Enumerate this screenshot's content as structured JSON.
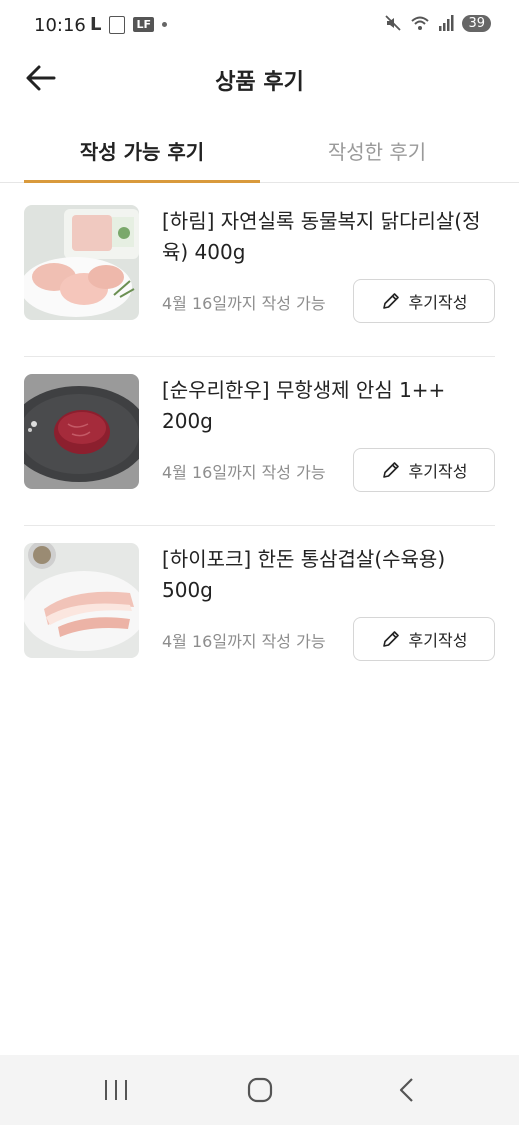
{
  "status_bar": {
    "time": "10:16",
    "battery": "39",
    "left_icons": [
      "l-icon",
      "image-icon",
      "lf-icon",
      "dot-icon"
    ],
    "right_icons": [
      "mute-icon",
      "wifi-icon",
      "signal-icon",
      "battery-icon"
    ]
  },
  "header": {
    "title": "상품 후기",
    "back_icon": "arrow-left-icon"
  },
  "tabs": [
    {
      "label": "작성 가능 후기",
      "active": true
    },
    {
      "label": "작성한 후기",
      "active": false
    }
  ],
  "accent_color": "#d99a3c",
  "items": [
    {
      "name": "[하림] 자연실록 동물복지 닭다리살(정육) 400g",
      "deadline": "4월 16일까지 작성 가능",
      "button_label": "후기작성",
      "image": "chicken-thigh-photo"
    },
    {
      "name": "[순우리한우] 무항생제 안심 1++ 200g",
      "deadline": "4월 16일까지 작성 가능",
      "button_label": "후기작성",
      "image": "beef-tenderloin-photo"
    },
    {
      "name": "[하이포크] 한돈 통삼겹살(수육용) 500g",
      "deadline": "4월 16일까지 작성 가능",
      "button_label": "후기작성",
      "image": "pork-belly-photo"
    }
  ],
  "nav_bar": [
    "recent-apps-icon",
    "home-icon",
    "back-icon"
  ]
}
